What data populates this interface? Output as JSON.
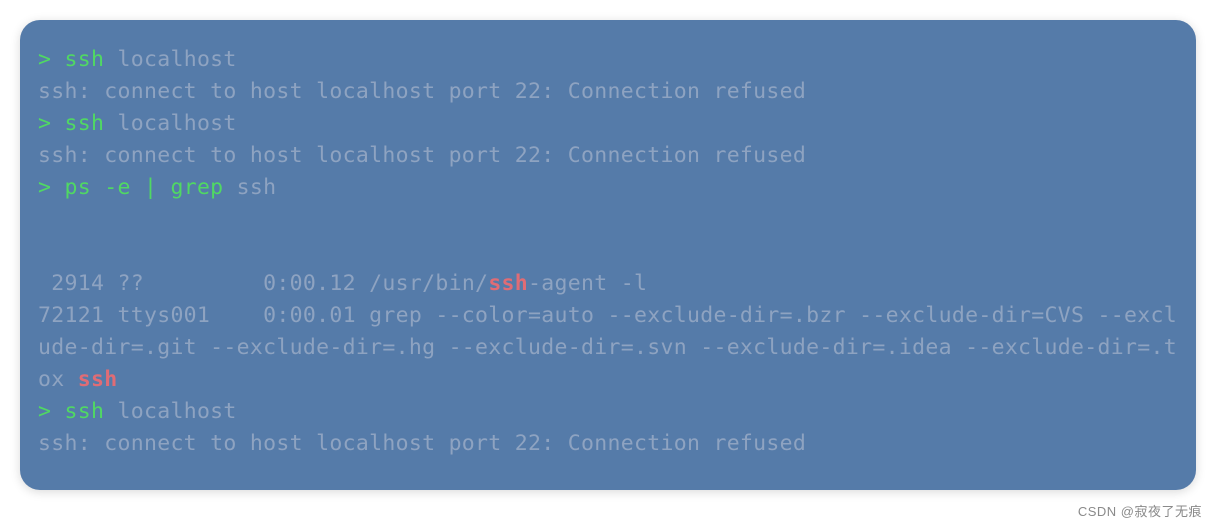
{
  "terminal": {
    "lines": [
      {
        "prompt": ">",
        "cmd_green": "ssh",
        "cmd_plain": " localhost"
      },
      {
        "out": "ssh: connect to host localhost port 22: Connection refused"
      },
      {
        "prompt": ">",
        "cmd_green": "ssh",
        "cmd_plain": " localhost"
      },
      {
        "out": "ssh: connect to host localhost port 22: Connection refused"
      },
      {
        "prompt": ">",
        "cmd_green": "ps -e | grep",
        "cmd_plain": " ssh"
      },
      {
        "blank": true
      },
      {
        "blank": true
      },
      {
        "ps_pre": " 2914 ??         0:00.12 /usr/bin/",
        "ps_hl": "ssh",
        "ps_post": "-agent -l"
      },
      {
        "wrap_pre": "72121 ttys001    0:00.01 grep --color=auto --exclude-dir=.bzr --exclude-dir=CVS --exclude-dir=.git --exclude-dir=.hg --exclude-dir=.svn --exclude-dir=.idea --exclude-dir=.tox ",
        "wrap_hl": "ssh"
      },
      {
        "prompt": ">",
        "cmd_green": "ssh",
        "cmd_plain": " localhost"
      },
      {
        "out": "ssh: connect to host localhost port 22: Connection refused"
      }
    ]
  },
  "watermark": "CSDN @寂夜了无痕"
}
